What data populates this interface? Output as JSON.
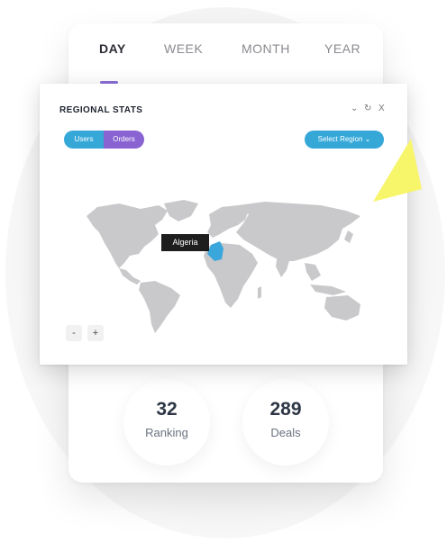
{
  "tabs": [
    {
      "label": "DAY",
      "active": true
    },
    {
      "label": "WEEK",
      "active": false
    },
    {
      "label": "MONTH",
      "active": false
    },
    {
      "label": "YEAR",
      "active": false
    }
  ],
  "widget": {
    "title": "REGIONAL STATS",
    "controls": {
      "collapse": "⌄",
      "refresh": "↻",
      "close": "X"
    },
    "toggle": {
      "users_label": "Users",
      "orders_label": "Orders",
      "selected": "Orders"
    },
    "select_region_label": "Select Region ⌄",
    "tooltip_country": "Algeria",
    "zoom_out_label": "-",
    "zoom_in_label": "+"
  },
  "stats": [
    {
      "value": "32",
      "label": "Ranking"
    },
    {
      "value": "289",
      "label": "Deals"
    }
  ],
  "colors": {
    "accent_blue": "#35a8d8",
    "accent_purple": "#8a63d2",
    "map_land": "#c9c9cb",
    "highlight": "#3aa7dc",
    "pointer": "#f7f56a"
  },
  "icons": [
    "chevron-down-icon",
    "refresh-icon",
    "close-icon",
    "pointer-arrow-icon"
  ]
}
